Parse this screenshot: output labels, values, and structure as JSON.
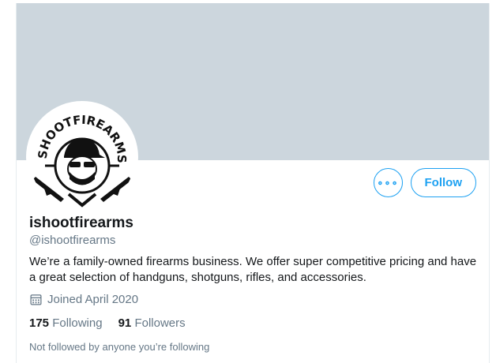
{
  "profile": {
    "display_name": "ishootfirearms",
    "handle": "@ishootfirearms",
    "bio": "We’re a family-owned firearms business. We offer super competitive pricing and have a great selection of handguns, shotguns, rifles, and accessories.",
    "joined": "Joined April 2020",
    "following_count": "175",
    "following_label": "Following",
    "followers_count": "91",
    "followers_label": "Followers",
    "not_followed_text": "Not followed by anyone you’re following",
    "avatar_logo_text": "iSHOOTFIREARMS"
  },
  "actions": {
    "more_label": "∘∘∘",
    "follow_label": "Follow"
  },
  "colors": {
    "accent": "#1da1f2",
    "banner": "#ccd6dd",
    "secondary_text": "#657786"
  },
  "icons": {
    "joined": "calendar-icon",
    "more": "more-options-icon"
  }
}
